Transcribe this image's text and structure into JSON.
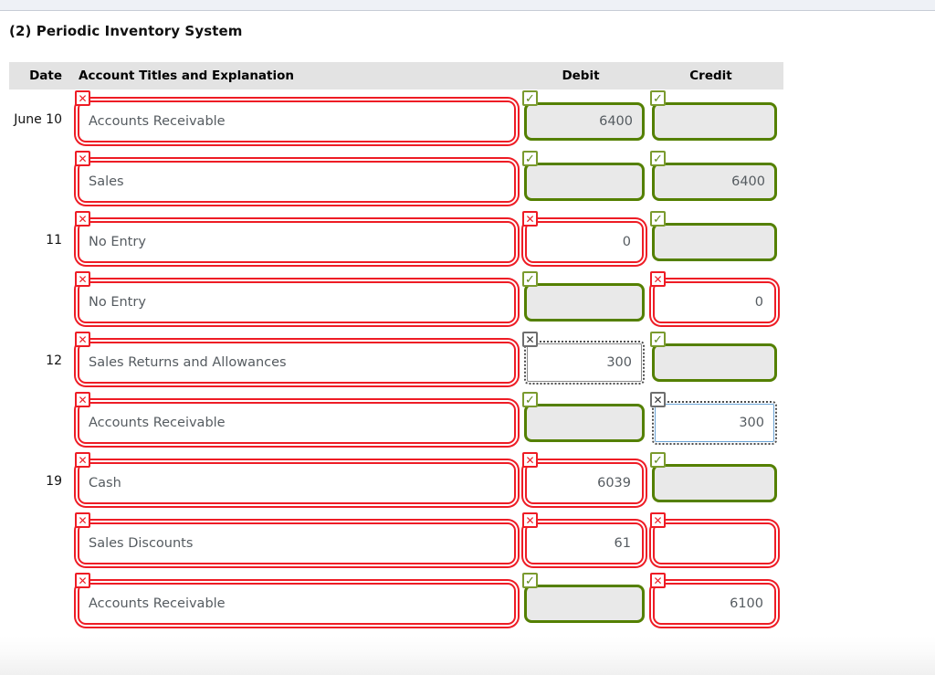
{
  "page": {
    "title": "(2) Periodic Inventory System"
  },
  "table": {
    "headers": {
      "date": "Date",
      "account": "Account Titles and Explanation",
      "debit": "Debit",
      "credit": "Credit"
    },
    "rows": [
      {
        "date": "June 10",
        "account": {
          "value": "Accounts Receivable",
          "state": "wrong",
          "badge": "x-red",
          "indent": false
        },
        "debit": {
          "value": "6400",
          "state": "correct",
          "badge": "check"
        },
        "credit": {
          "value": "",
          "state": "correct",
          "badge": "check"
        }
      },
      {
        "date": "",
        "account": {
          "value": "Sales",
          "state": "wrong",
          "badge": "x-red",
          "indent": true
        },
        "debit": {
          "value": "",
          "state": "correct",
          "badge": "check"
        },
        "credit": {
          "value": "6400",
          "state": "correct",
          "badge": "check"
        }
      },
      {
        "date": "11",
        "account": {
          "value": "No Entry",
          "state": "wrong",
          "badge": "x-red",
          "indent": false
        },
        "debit": {
          "value": "0",
          "state": "wrong",
          "badge": "x-red"
        },
        "credit": {
          "value": "",
          "state": "correct",
          "badge": "check"
        }
      },
      {
        "date": "",
        "account": {
          "value": "No Entry",
          "state": "wrong",
          "badge": "x-red",
          "indent": true
        },
        "debit": {
          "value": "",
          "state": "correct",
          "badge": "check"
        },
        "credit": {
          "value": "0",
          "state": "wrong",
          "badge": "x-red"
        }
      },
      {
        "date": "12",
        "account": {
          "value": "Sales Returns and Allowances",
          "state": "wrong",
          "badge": "x-red",
          "indent": false
        },
        "debit": {
          "value": "300",
          "state": "pending",
          "badge": "x-gray"
        },
        "credit": {
          "value": "",
          "state": "correct",
          "badge": "check"
        }
      },
      {
        "date": "",
        "account": {
          "value": "Accounts Receivable",
          "state": "wrong",
          "badge": "x-red",
          "indent": true
        },
        "debit": {
          "value": "",
          "state": "correct",
          "badge": "check"
        },
        "credit": {
          "value": "300",
          "state": "focused",
          "badge": "x-gray"
        }
      },
      {
        "date": "19",
        "account": {
          "value": "Cash",
          "state": "wrong",
          "badge": "x-red",
          "indent": false
        },
        "debit": {
          "value": "6039",
          "state": "wrong",
          "badge": "x-red"
        },
        "credit": {
          "value": "",
          "state": "correct",
          "badge": "check"
        }
      },
      {
        "date": "",
        "account": {
          "value": "Sales Discounts",
          "state": "wrong",
          "badge": "x-red",
          "indent": false
        },
        "debit": {
          "value": "61",
          "state": "wrong",
          "badge": "x-red"
        },
        "credit": {
          "value": "",
          "state": "wrong",
          "badge": "x-red"
        }
      },
      {
        "date": "",
        "account": {
          "value": "Accounts Receivable",
          "state": "wrong",
          "badge": "x-red",
          "indent": true
        },
        "debit": {
          "value": "",
          "state": "correct",
          "badge": "check"
        },
        "credit": {
          "value": "6100",
          "state": "wrong",
          "badge": "x-red"
        }
      }
    ],
    "badge_glyphs": {
      "x-red": "✕",
      "x-gray": "✕",
      "check": "✓"
    }
  },
  "colors": {
    "error": "#ee1c25",
    "success": "#548000",
    "header_band": "#e3e3e3",
    "focus_blue": "#6aa3d5"
  }
}
